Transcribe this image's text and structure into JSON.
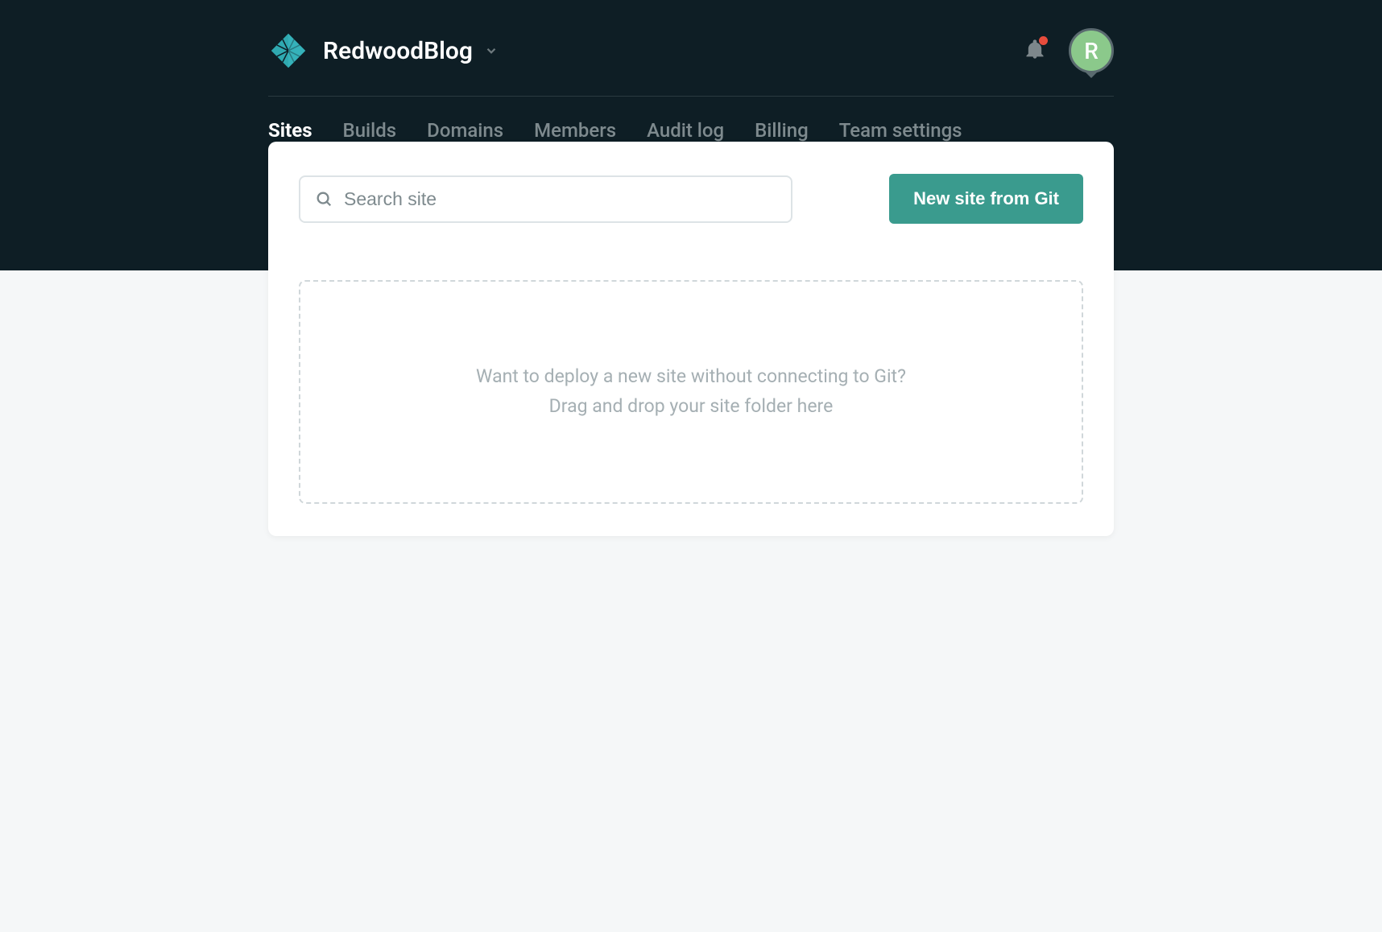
{
  "header": {
    "team_name": "RedwoodBlog",
    "avatar_initial": "R"
  },
  "nav": {
    "tabs": [
      {
        "label": "Sites",
        "active": true
      },
      {
        "label": "Builds",
        "active": false
      },
      {
        "label": "Domains",
        "active": false
      },
      {
        "label": "Members",
        "active": false
      },
      {
        "label": "Audit log",
        "active": false
      },
      {
        "label": "Billing",
        "active": false
      },
      {
        "label": "Team settings",
        "active": false
      }
    ]
  },
  "main": {
    "search_placeholder": "Search site",
    "new_site_button": "New site from Git",
    "drop_zone": {
      "line1": "Want to deploy a new site without connecting to Git?",
      "line2": "Drag and drop your site folder here"
    }
  }
}
